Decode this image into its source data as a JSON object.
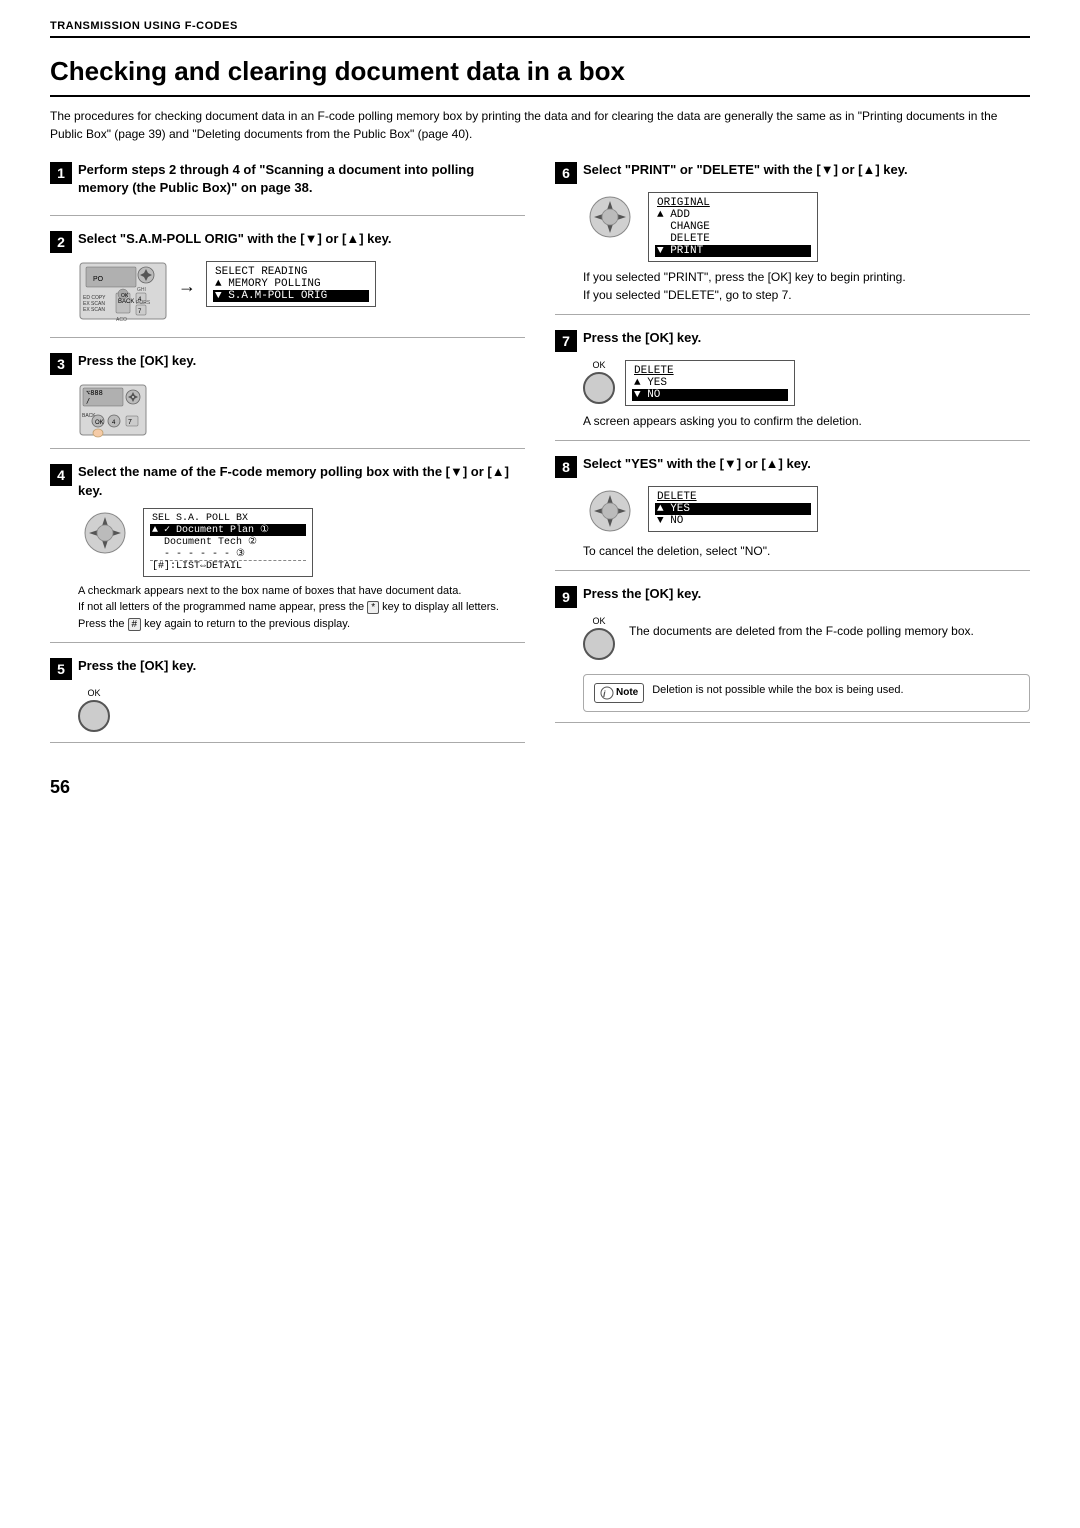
{
  "header": {
    "title": "TRANSMISSION USING F-CODES"
  },
  "page": {
    "title": "Checking and clearing document data in a box",
    "intro": "The procedures for checking document data in an F-code polling memory box by printing the data and for clearing the data are generally the same as in \"Printing documents in the Public Box\" (page 39) and \"Deleting documents from the Public Box\" (page 40).",
    "page_number": "56"
  },
  "steps": {
    "step1": {
      "num": "1",
      "title": "Perform steps 2 through 4 of \"Scanning a document into polling memory (the Public Box)\" on page 38."
    },
    "step2": {
      "num": "2",
      "title": "Select \"S.A.M-POLL ORIG\" with the [▼] or [▲] key.",
      "screen": {
        "line1": "SELECT READING",
        "line2": "▲ MEMORY POLLING",
        "line3": "▼ S.A.M-POLL ORIG",
        "line3_highlight": true
      }
    },
    "step3": {
      "num": "3",
      "title": "Press the [OK] key."
    },
    "step4": {
      "num": "4",
      "title": "Select the name of the F-code memory polling box with the [▼] or [▲] key.",
      "screen": {
        "line1": "SEL S.A. POLL BX",
        "line2": "✓ Document Plan  1",
        "line3": "  Document Tech  2",
        "line4": "  - - - - - -    3",
        "line5": "[#]:LIST⇔DETAIL",
        "line2_highlight": true
      },
      "note": "A checkmark appears next to the box name of boxes that have document data.\nIf not all letters of the programmed name appear, press the * key to display all letters. Press the # key again to return to the previous display."
    },
    "step5": {
      "num": "5",
      "title": "Press the [OK] key."
    },
    "step6": {
      "num": "6",
      "title": "Select \"PRINT\" or \"DELETE\" with the [▼] or [▲] key.",
      "screen": {
        "line1": "ORIGINAL",
        "line2": "▲ ADD",
        "line3": "  CHANGE",
        "line4": "  DELETE",
        "line5": "▼ PRINT",
        "line5_highlight": true
      },
      "note1": "If you selected \"PRINT\", press the [OK] key to begin printing.",
      "note2": "If you selected \"DELETE\", go to step 7."
    },
    "step7": {
      "num": "7",
      "title": "Press the [OK] key.",
      "screen": {
        "line1": "DELETE",
        "line2": "▲ YES",
        "line3": "▼ NO",
        "line3_highlight": true
      },
      "note": "A screen appears asking you to confirm the deletion."
    },
    "step8": {
      "num": "8",
      "title": "Select \"YES\" with the [▼] or [▲] key.",
      "screen": {
        "line1": "DELETE",
        "line2": "▲ YES",
        "line2_highlight": true,
        "line3": "▼ NO"
      },
      "note": "To cancel the deletion, select \"NO\"."
    },
    "step9": {
      "num": "9",
      "title": "Press the [OK] key.",
      "note": "The documents are deleted from the F-code polling memory box.",
      "note2": "Deletion is not possible while the box is being used."
    }
  }
}
